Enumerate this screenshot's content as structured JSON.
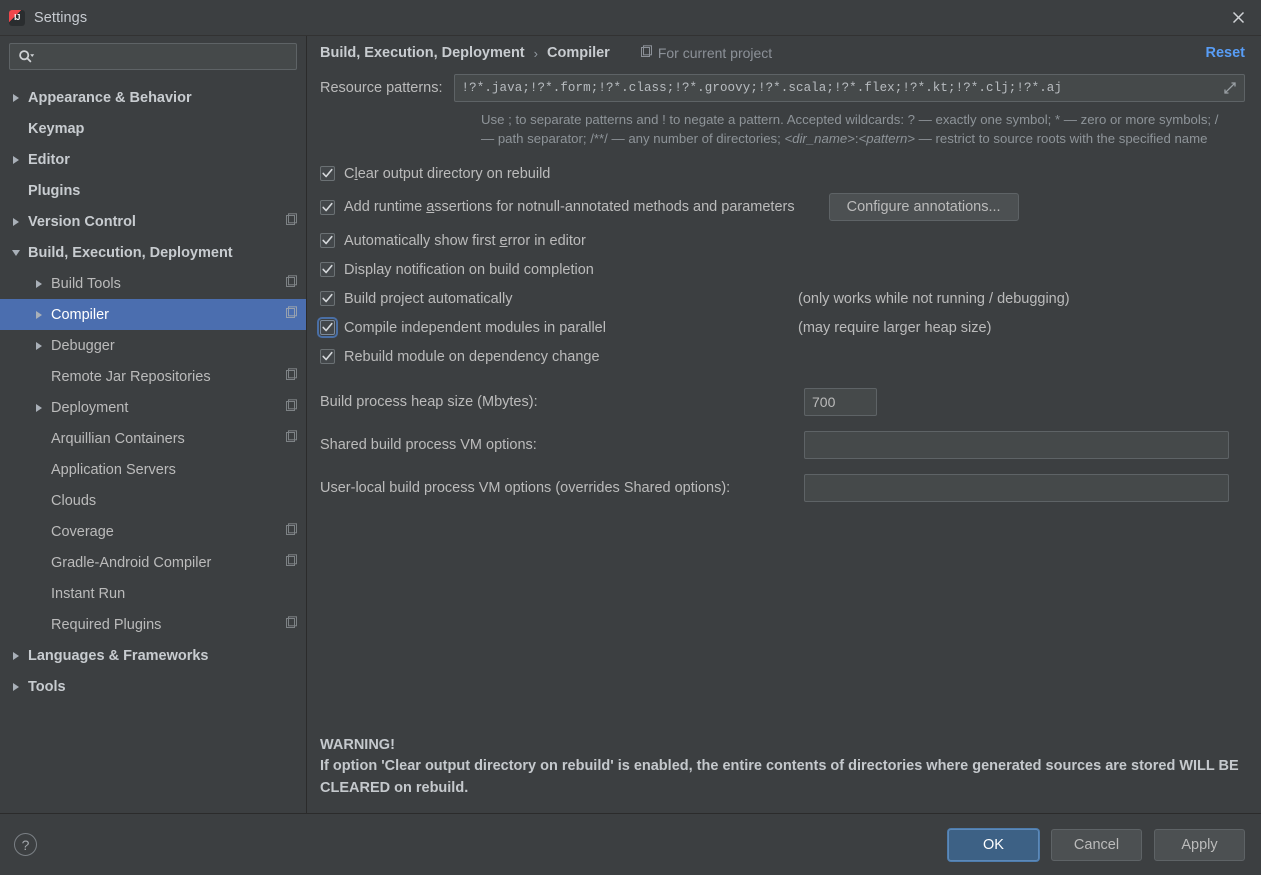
{
  "window": {
    "title": "Settings",
    "app_icon": "intellij-idea-icon",
    "close_icon": "close-icon"
  },
  "sidebar": {
    "search": {
      "placeholder": "",
      "value": "",
      "icon": "search-icon"
    },
    "items": [
      {
        "label": "Appearance & Behavior",
        "level": 0,
        "twisty": "right",
        "bold": true,
        "config_icon": false,
        "selected": false
      },
      {
        "label": "Keymap",
        "level": 0,
        "twisty": "none",
        "bold": true,
        "config_icon": false,
        "selected": false
      },
      {
        "label": "Editor",
        "level": 0,
        "twisty": "right",
        "bold": true,
        "config_icon": false,
        "selected": false
      },
      {
        "label": "Plugins",
        "level": 0,
        "twisty": "none",
        "bold": true,
        "config_icon": false,
        "selected": false
      },
      {
        "label": "Version Control",
        "level": 0,
        "twisty": "right",
        "bold": true,
        "config_icon": true,
        "selected": false
      },
      {
        "label": "Build, Execution, Deployment",
        "level": 0,
        "twisty": "down",
        "bold": true,
        "config_icon": false,
        "selected": false
      },
      {
        "label": "Build Tools",
        "level": 1,
        "twisty": "right",
        "bold": false,
        "config_icon": true,
        "selected": false
      },
      {
        "label": "Compiler",
        "level": 1,
        "twisty": "right",
        "bold": false,
        "config_icon": true,
        "selected": true
      },
      {
        "label": "Debugger",
        "level": 1,
        "twisty": "right",
        "bold": false,
        "config_icon": false,
        "selected": false
      },
      {
        "label": "Remote Jar Repositories",
        "level": 1,
        "twisty": "none",
        "bold": false,
        "config_icon": true,
        "selected": false
      },
      {
        "label": "Deployment",
        "level": 1,
        "twisty": "right",
        "bold": false,
        "config_icon": true,
        "selected": false
      },
      {
        "label": "Arquillian Containers",
        "level": 1,
        "twisty": "none",
        "bold": false,
        "config_icon": true,
        "selected": false
      },
      {
        "label": "Application Servers",
        "level": 1,
        "twisty": "none",
        "bold": false,
        "config_icon": false,
        "selected": false
      },
      {
        "label": "Clouds",
        "level": 1,
        "twisty": "none",
        "bold": false,
        "config_icon": false,
        "selected": false
      },
      {
        "label": "Coverage",
        "level": 1,
        "twisty": "none",
        "bold": false,
        "config_icon": true,
        "selected": false
      },
      {
        "label": "Gradle-Android Compiler",
        "level": 1,
        "twisty": "none",
        "bold": false,
        "config_icon": true,
        "selected": false
      },
      {
        "label": "Instant Run",
        "level": 1,
        "twisty": "none",
        "bold": false,
        "config_icon": false,
        "selected": false
      },
      {
        "label": "Required Plugins",
        "level": 1,
        "twisty": "none",
        "bold": false,
        "config_icon": true,
        "selected": false
      },
      {
        "label": "Languages & Frameworks",
        "level": 0,
        "twisty": "right",
        "bold": true,
        "config_icon": false,
        "selected": false
      },
      {
        "label": "Tools",
        "level": 0,
        "twisty": "right",
        "bold": true,
        "config_icon": false,
        "selected": false
      }
    ]
  },
  "breadcrumb": {
    "parent": "Build, Execution, Deployment",
    "separator": "›",
    "current": "Compiler",
    "scope_label": "For current project",
    "scope_icon": "project-scope-icon",
    "reset_label": "Reset"
  },
  "main": {
    "resource_patterns_label": "Resource patterns:",
    "resource_patterns_value": "!?*.java;!?*.form;!?*.class;!?*.groovy;!?*.scala;!?*.flex;!?*.kt;!?*.clj;!?*.aj",
    "expand_icon": "expand-diagonal-icon",
    "hint_part1": "Use ; to separate patterns and ! to negate a pattern. Accepted wildcards: ? — exactly one symbol; * — zero or more symbols; / — path separator; /**/ — any number of directories; ",
    "hint_dir_name": "<dir_name>",
    "hint_colon": ":",
    "hint_pattern": "<pattern>",
    "hint_part2": " — restrict to source roots with the specified name",
    "checkboxes": [
      {
        "label": "Clear output directory on rebuild",
        "mnemonic_before": "C",
        "mnemonic": "l",
        "mnemonic_after": "ear output directory on rebuild",
        "checked": true,
        "focused": false,
        "note": "",
        "button": ""
      },
      {
        "label": "Add runtime assertions for notnull-annotated methods and parameters",
        "mnemonic_before": "Add runtime ",
        "mnemonic": "a",
        "mnemonic_after": "ssertions for notnull-annotated methods and parameters",
        "checked": true,
        "focused": false,
        "note": "",
        "button": "Configure annotations..."
      },
      {
        "label": "Automatically show first error in editor",
        "mnemonic_before": "Automatically show first ",
        "mnemonic": "e",
        "mnemonic_after": "rror in editor",
        "checked": true,
        "focused": false,
        "note": "",
        "button": ""
      },
      {
        "label": "Display notification on build completion",
        "mnemonic_before": "Display notification on build completion",
        "mnemonic": "",
        "mnemonic_after": "",
        "checked": true,
        "focused": false,
        "note": "",
        "button": ""
      },
      {
        "label": "Build project automatically",
        "mnemonic_before": "Build project automatically",
        "mnemonic": "",
        "mnemonic_after": "",
        "checked": true,
        "focused": false,
        "note": "(only works while not running / debugging)",
        "button": ""
      },
      {
        "label": "Compile independent modules in parallel",
        "mnemonic_before": "Compile independent modules in parallel",
        "mnemonic": "",
        "mnemonic_after": "",
        "checked": true,
        "focused": true,
        "note": "(may require larger heap size)",
        "button": ""
      },
      {
        "label": "Rebuild module on dependency change",
        "mnemonic_before": "Rebuild module on dependency change",
        "mnemonic": "",
        "mnemonic_after": "",
        "checked": true,
        "focused": false,
        "note": "",
        "button": ""
      }
    ],
    "heap_label": "Build process heap size (Mbytes):",
    "heap_value": "700",
    "shared_vm_label": "Shared build process VM options:",
    "shared_vm_value": "",
    "userlocal_vm_label": "User-local build process VM options (overrides Shared options):",
    "userlocal_vm_value": "",
    "warning_title": "WARNING!",
    "warning_body": "If option 'Clear output directory on rebuild' is enabled, the entire contents of directories where generated sources are stored WILL BE CLEARED on rebuild."
  },
  "footer": {
    "help_label": "?",
    "ok_label": "OK",
    "cancel_label": "Cancel",
    "apply_label": "Apply"
  },
  "colors": {
    "background": "#3c3f41",
    "selection_blue": "#4b6eaf",
    "link_blue": "#589df6",
    "primary_button": "#3d6185",
    "text": "#bbbbbb",
    "muted_text": "#8e9499"
  }
}
